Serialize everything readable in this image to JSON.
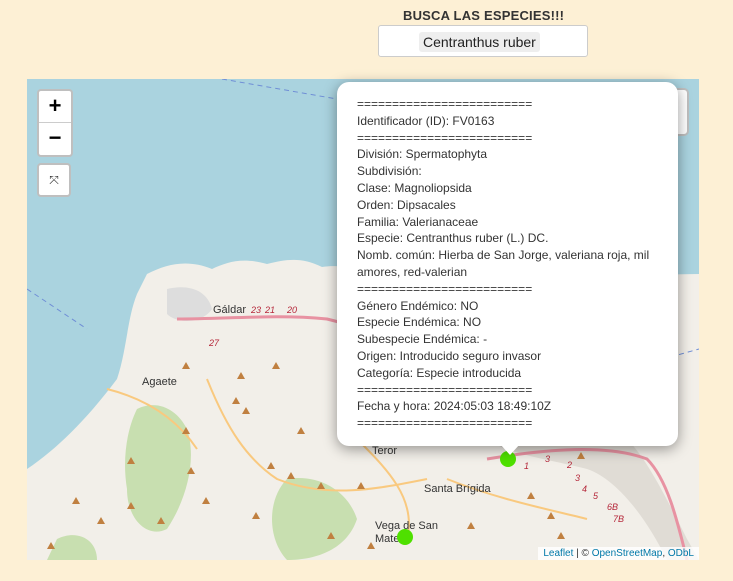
{
  "header": {
    "title": "BUSCA LAS ESPECIES!!!"
  },
  "search": {
    "value": "Centranthus ruber"
  },
  "controls": {
    "zoom_in": "+",
    "zoom_out": "−",
    "fullscreen": "⤧",
    "layers_icon": "layers-icon"
  },
  "map": {
    "places": [
      "Gáldar",
      "Agaete",
      "Teror",
      "Santa Brígida",
      "Vega de San",
      "Mateo"
    ],
    "road_numbers": [
      "23",
      "21",
      "20",
      "27",
      "3",
      "2",
      "1",
      "3",
      "4",
      "5",
      "6B",
      "7B"
    ],
    "marker_color": "#4fe000"
  },
  "attribution": {
    "leaflet": "Leaflet",
    "sep": " | © ",
    "osm": "OpenStreetMap",
    "comma": ", ",
    "odbl": "ODbL"
  },
  "popup": {
    "lines": [
      "=========================",
      "Identificador (ID): FV0163",
      "=========================",
      "División: Spermatophyta",
      "Subdivisión:",
      "Clase: Magnoliopsida",
      "Orden: Dipsacales",
      "Familia: Valerianaceae",
      "Especie: Centranthus ruber (L.) DC.",
      "Nomb. común: Hierba de San Jorge, valeriana roja, mil amores, red-valerian",
      "=========================",
      "Género Endémico: NO",
      "Especie Endémica: NO",
      "Subespecie Endémica: -",
      "Origen: Introducido seguro invasor",
      "Categoría: Especie introducida",
      "=========================",
      "Fecha y hora: 2024:05:03 18:49:10Z",
      "========================="
    ]
  }
}
